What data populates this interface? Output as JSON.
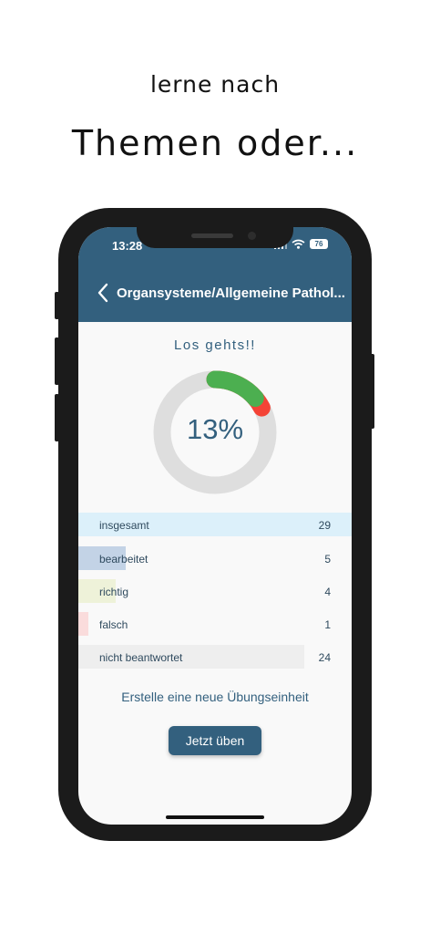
{
  "promo": {
    "line1": "lerne nach",
    "line2": "Themen oder..."
  },
  "status_bar": {
    "time": "13:28",
    "battery": "76"
  },
  "header": {
    "title": "Organsysteme/Allgemeine Pathol..."
  },
  "progress": {
    "heading": "Los gehts!!",
    "percent_label": "13%",
    "correct_fraction": 0.138,
    "wrong_fraction": 0.035
  },
  "stats": [
    {
      "label": "insgesamt",
      "value": "29",
      "fraction": 1.0,
      "color": "#dcf0fa"
    },
    {
      "label": "bearbeitet",
      "value": "5",
      "fraction": 0.172,
      "color": "#c3d3e6"
    },
    {
      "label": "richtig",
      "value": "4",
      "fraction": 0.138,
      "color": "#eef2d9"
    },
    {
      "label": "falsch",
      "value": "1",
      "fraction": 0.035,
      "color": "#fadcdc"
    },
    {
      "label": "nicht beantwortet",
      "value": "24",
      "fraction": 0.828,
      "color": "#eeeeee"
    }
  ],
  "cta": {
    "text": "Erstelle eine neue Übungseinheit",
    "button": "Jetzt üben"
  },
  "colors": {
    "accent": "#33607e",
    "correct": "#4caf50",
    "wrong": "#f44336",
    "track": "#dedede"
  }
}
